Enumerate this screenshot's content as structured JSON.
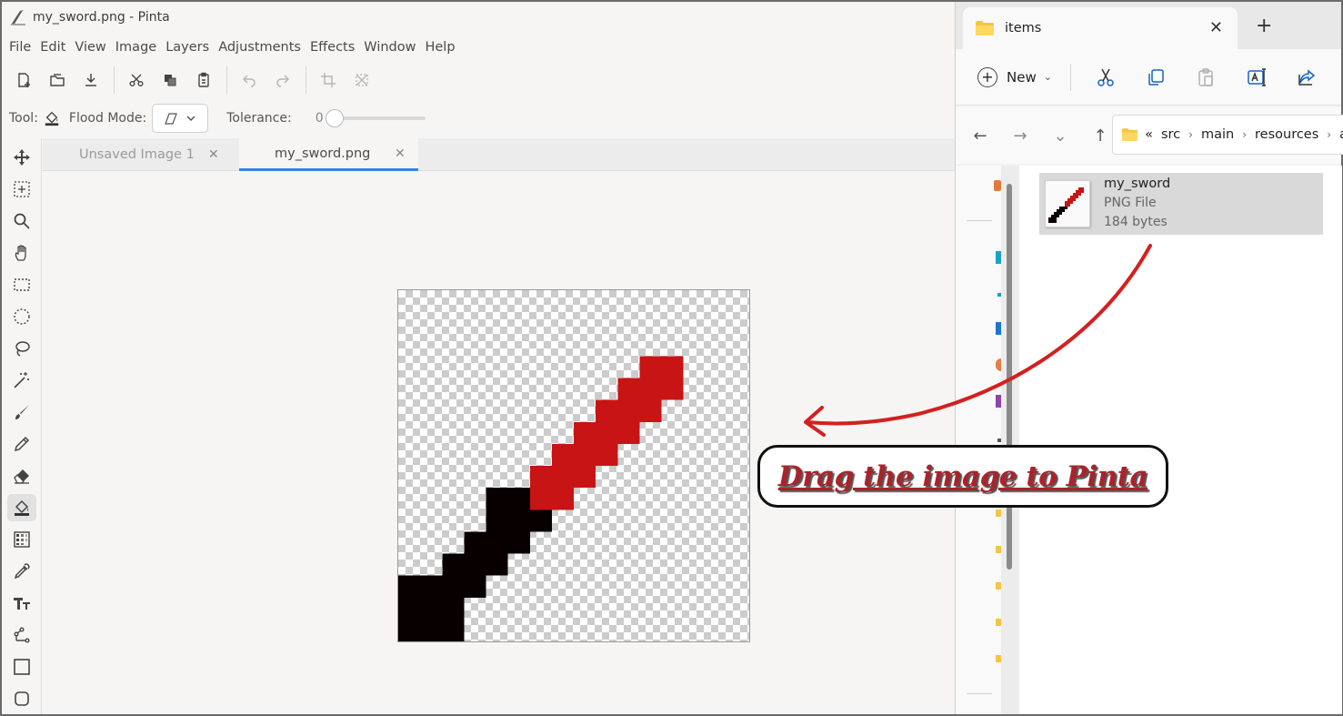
{
  "pinta": {
    "window_title": "my_sword.png - Pinta",
    "menu": [
      "File",
      "Edit",
      "View",
      "Image",
      "Layers",
      "Adjustments",
      "Effects",
      "Window",
      "Help"
    ],
    "toolbar_icons": [
      "new-image-icon",
      "open-icon",
      "save-icon",
      "cut-icon",
      "copy-icon",
      "paste-icon",
      "undo-icon",
      "redo-icon",
      "crop-icon",
      "deselect-icon"
    ],
    "options": {
      "tool_label": "Tool:",
      "flood_mode_label": "Flood Mode:",
      "tolerance_label": "Tolerance:",
      "tolerance_value": "0"
    },
    "tools": [
      "move-selection-icon",
      "move-selected-icon",
      "zoom-icon",
      "pan-icon",
      "rectangle-select-icon",
      "ellipse-select-icon",
      "lasso-icon",
      "magic-wand-icon",
      "paintbrush-icon",
      "pencil-icon",
      "eraser-icon",
      "paint-bucket-icon",
      "gradient-icon",
      "color-picker-icon",
      "text-icon",
      "line-curve-icon",
      "rectangle-icon",
      "rounded-rectangle-icon"
    ],
    "active_tool": "paint-bucket-icon",
    "tabs": [
      {
        "label": "Unsaved Image 1",
        "active": false
      },
      {
        "label": "my_sword.png",
        "active": true
      }
    ],
    "colors": {
      "sword_red": "#c81414",
      "sword_black": "#080000",
      "accent": "#3584e4"
    }
  },
  "explorer": {
    "tab_title": "items",
    "new_label": "New",
    "cmd_icons": [
      "cut-icon",
      "copy-icon",
      "paste-icon",
      "rename-icon",
      "share-icon"
    ],
    "breadcrumb_overflow": "«",
    "breadcrumb": [
      "src",
      "main",
      "resources",
      "a"
    ],
    "file": {
      "name": "my_sword",
      "type": "PNG File",
      "size": "184 bytes"
    }
  },
  "annotation": {
    "text": "Drag the image to Pinta",
    "color": "#a8242c"
  }
}
